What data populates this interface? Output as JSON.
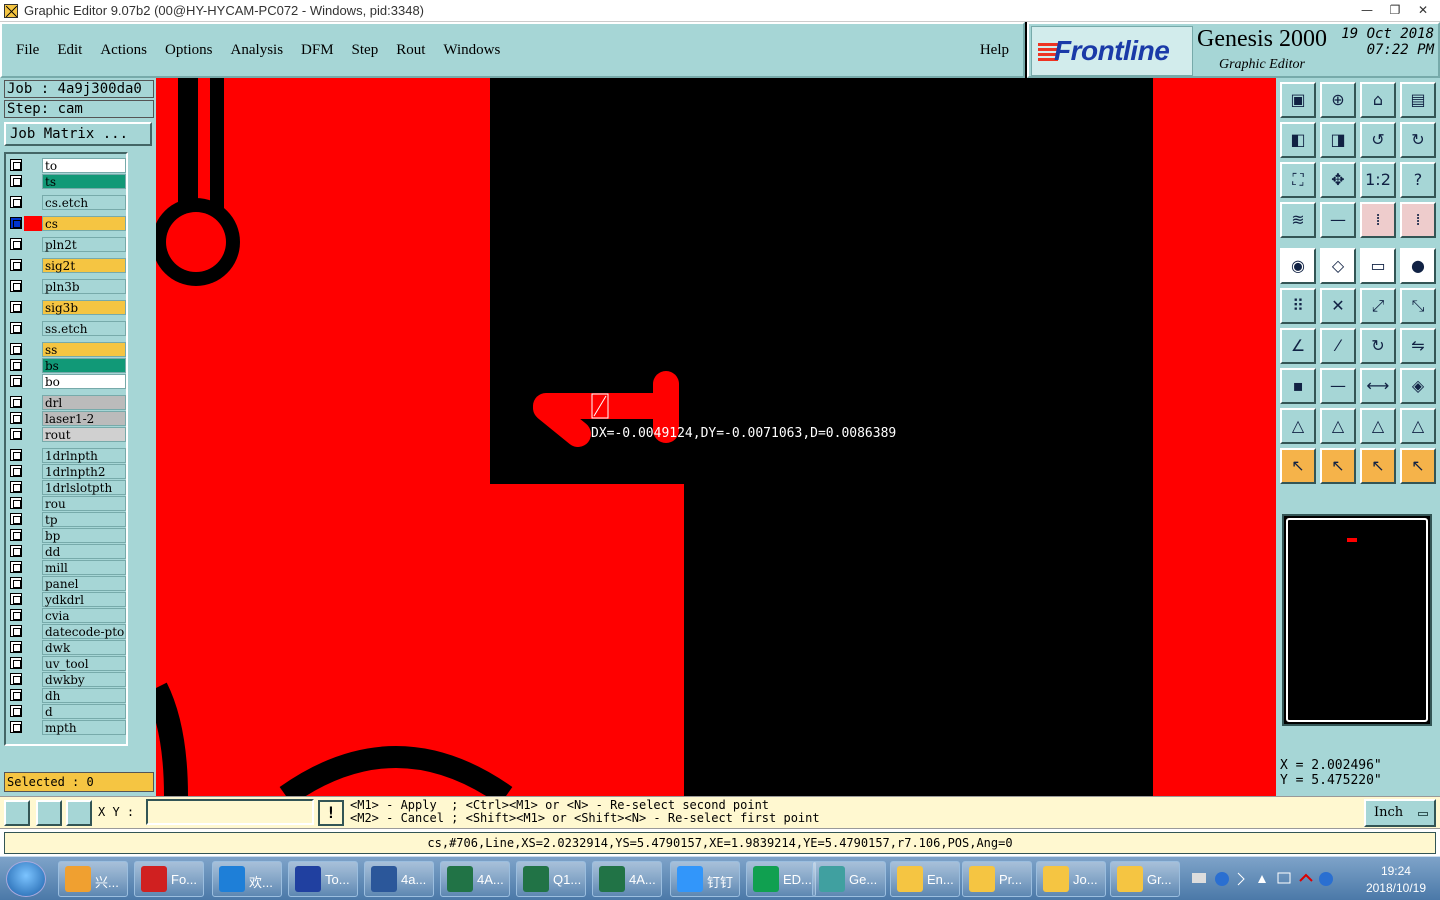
{
  "window": {
    "title": "Graphic Editor 9.07b2 (00@HY-HYCAM-PC072 - Windows, pid:3348)",
    "controls": [
      "—",
      "❐",
      "✕"
    ]
  },
  "menu": {
    "items": [
      "File",
      "Edit",
      "Actions",
      "Options",
      "Analysis",
      "DFM",
      "Step",
      "Rout",
      "Windows"
    ],
    "help": "Help"
  },
  "logo": {
    "brand": "Frontline",
    "product": "Genesis 2000",
    "subtitle": "Graphic Editor",
    "date": "19 Oct 2018",
    "time": "07:22 PM"
  },
  "job": {
    "job_label": "Job  :  4a9j300da0",
    "step_label": "Step: cam",
    "matrix_button": "Job Matrix ..."
  },
  "layers": [
    {
      "name": "to",
      "bg": "#ffffff"
    },
    {
      "name": "ts",
      "bg": "#119977"
    },
    {
      "name": "cs.etch",
      "bg": "#a6d6d6"
    },
    {
      "name": "cs",
      "bg": "#f5c542",
      "cap": "#f00",
      "active": true
    },
    {
      "name": "pln2t",
      "bg": "#a6d6d6"
    },
    {
      "name": "sig2t",
      "bg": "#f5c542"
    },
    {
      "name": "pln3b",
      "bg": "#a6d6d6"
    },
    {
      "name": "sig3b",
      "bg": "#f5c542"
    },
    {
      "name": "ss.etch",
      "bg": "#a6d6d6"
    },
    {
      "name": "ss",
      "bg": "#f5c542"
    },
    {
      "name": "bs",
      "bg": "#119977"
    },
    {
      "name": "bo",
      "bg": "#ffffff"
    },
    {
      "name": "drl",
      "bg": "#bbbbbb"
    },
    {
      "name": "laser1-2",
      "bg": "#bbbbbb"
    },
    {
      "name": "rout",
      "bg": "#d0d0d0"
    },
    {
      "name": "1drlnpth",
      "bg": "#a6d6d6"
    },
    {
      "name": "1drlnpth2",
      "bg": "#a6d6d6"
    },
    {
      "name": "1drlslotpth",
      "bg": "#a6d6d6"
    },
    {
      "name": "rou",
      "bg": "#a6d6d6"
    },
    {
      "name": "tp",
      "bg": "#a6d6d6"
    },
    {
      "name": "bp",
      "bg": "#a6d6d6"
    },
    {
      "name": "dd",
      "bg": "#a6d6d6"
    },
    {
      "name": "mill",
      "bg": "#a6d6d6"
    },
    {
      "name": "panel",
      "bg": "#a6d6d6"
    },
    {
      "name": "ydkdrl",
      "bg": "#a6d6d6"
    },
    {
      "name": "cvia",
      "bg": "#a6d6d6"
    },
    {
      "name": "datecode-pto",
      "bg": "#a6d6d6"
    },
    {
      "name": "dwk",
      "bg": "#a6d6d6"
    },
    {
      "name": "uv_tool",
      "bg": "#a6d6d6"
    },
    {
      "name": "dwkby",
      "bg": "#a6d6d6"
    },
    {
      "name": "dh",
      "bg": "#a6d6d6"
    },
    {
      "name": "d",
      "bg": "#a6d6d6"
    },
    {
      "name": "mpth",
      "bg": "#a6d6d6"
    }
  ],
  "selected": "Selected : 0",
  "canvas": {
    "measure": "DX=-0.0049124,DY=-0.0071063,D=0.0086389",
    "copper_color": "#ff0000"
  },
  "coords": {
    "x": "X  =  2.002496\"",
    "y": "Y  =  5.475220\""
  },
  "prompt": {
    "xy_label": "X Y :",
    "xy_value": "",
    "warn": "!",
    "hint1": "<M1> - Apply  ; <Ctrl><M1> or <N> - Re-select second point",
    "hint2": "<M2> - Cancel ; <Shift><M1> or <Shift><N> - Re-select first point",
    "unit": "Inch"
  },
  "status": "cs,#706,Line,XS=2.0232914,YS=5.4790157,XE=1.9839214,YE=5.4790157,r7.106,POS,Ang=0",
  "taskbar": {
    "tasks": [
      {
        "label": "兴...",
        "color": "#f0a030"
      },
      {
        "label": "Fo...",
        "color": "#d02020"
      },
      {
        "label": "欢...",
        "color": "#1e7fd8"
      },
      {
        "label": "To...",
        "color": "#2040a0"
      },
      {
        "label": "4a...",
        "color": "#2b579a"
      },
      {
        "label": "4A...",
        "color": "#217346"
      },
      {
        "label": "Q1...",
        "color": "#217346"
      },
      {
        "label": "4A...",
        "color": "#217346"
      },
      {
        "label": "钉钉",
        "color": "#3296fa"
      },
      {
        "label": "ED...",
        "color": "#10a050"
      },
      {
        "label": "Ge...",
        "color": "#40a0a0"
      },
      {
        "label": "En...",
        "color": "#f5c542"
      },
      {
        "label": "Pr...",
        "color": "#f5c542"
      },
      {
        "label": "Jo...",
        "color": "#f5c542"
      },
      {
        "label": "Gr...",
        "color": "#f5c542"
      }
    ],
    "time": "19:24",
    "date": "2018/10/19"
  }
}
